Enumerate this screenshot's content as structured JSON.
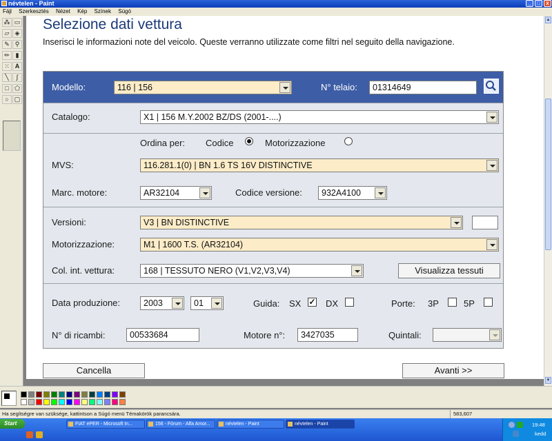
{
  "window": {
    "title": "névtelen - Paint",
    "buttons": {
      "minimize": "_",
      "maximize": "□",
      "close": "x"
    }
  },
  "menu": [
    "Fájl",
    "Szerkesztés",
    "Nézet",
    "Kép",
    "Színek",
    "Súgó"
  ],
  "page": {
    "title": "Selezione dati vettura",
    "intro": "Inserisci le informazioni note del veicolo. Queste verranno utilizzate come filtri nel seguito della navigazione."
  },
  "form": {
    "modello": {
      "label": "Modello:",
      "value": "116 | 156"
    },
    "telaio": {
      "label": "N° telaio:",
      "value": "01314649"
    },
    "catalogo": {
      "label": "Catalogo:",
      "value": "X1 | 156 M.Y.2002 BZ/DS (2001-....)"
    },
    "ordina": {
      "label": "Ordina per:",
      "options": [
        "Codice",
        "Motorizzazione"
      ],
      "selected": "Codice"
    },
    "mvs": {
      "label": "MVS:",
      "value": "116.281.1(0) | BN 1.6 TS 16V DISTINCTIVE"
    },
    "marc_motore": {
      "label": "Marc. motore:",
      "value": "AR32104"
    },
    "codice_versione": {
      "label": "Codice versione:",
      "value": "932A4100"
    },
    "versioni": {
      "label": "Versioni:",
      "value": "V3 | BN DISTINCTIVE",
      "extra": ""
    },
    "motorizzazione": {
      "label": "Motorizzazione:",
      "value": "M1 | 1600 T.S. (AR32104)"
    },
    "col_int": {
      "label": "Col. int. vettura:",
      "value": "168 | TESSUTO NERO (V1,V2,V3,V4)"
    },
    "visualizza_tessuti": "Visualizza tessuti",
    "data_produzione": {
      "label": "Data produzione:",
      "year": "2003",
      "month": "01"
    },
    "guida": {
      "label": "Guida:",
      "sx": "SX",
      "dx": "DX",
      "sx_checked": true,
      "dx_checked": false
    },
    "porte": {
      "label": "Porte:",
      "p3": "3P",
      "p5": "5P"
    },
    "ricambi": {
      "label": "N° di ricambi:",
      "value": "00533684"
    },
    "motore_no": {
      "label": "Motore n°:",
      "value": "3427035"
    },
    "quintali": {
      "label": "Quintali:",
      "value": ""
    }
  },
  "actions": {
    "cancel": "Cancella",
    "next": "Avanti >>"
  },
  "statusbar": {
    "help": "Ha segítségre van szüksége, kattintson a Súgó menü Témakörök parancsára.",
    "coords": "583,607"
  },
  "taskbar": {
    "start": "Start",
    "tasks": [
      "FIAT ePER - Microsoft In...",
      "156 - Fórum - Alfa Amor...",
      "névtelen - Paint",
      "névtelen - Paint"
    ],
    "time": "19:48",
    "day": "kedd"
  },
  "colors": {
    "header_band": "#3d5ea6",
    "highlight_field": "#fcecc8",
    "title": "#1a3a78",
    "palette": [
      "#000000",
      "#808080",
      "#800000",
      "#808000",
      "#008000",
      "#008080",
      "#000080",
      "#800080",
      "#808040",
      "#004040",
      "#0080ff",
      "#004080",
      "#8000ff",
      "#804000",
      "#ffffff",
      "#c0c0c0",
      "#ff0000",
      "#ffff00",
      "#00ff00",
      "#00ffff",
      "#0000ff",
      "#ff00ff",
      "#ffff80",
      "#00ff80",
      "#80ffff",
      "#8080ff",
      "#ff0080",
      "#ff8040"
    ]
  }
}
